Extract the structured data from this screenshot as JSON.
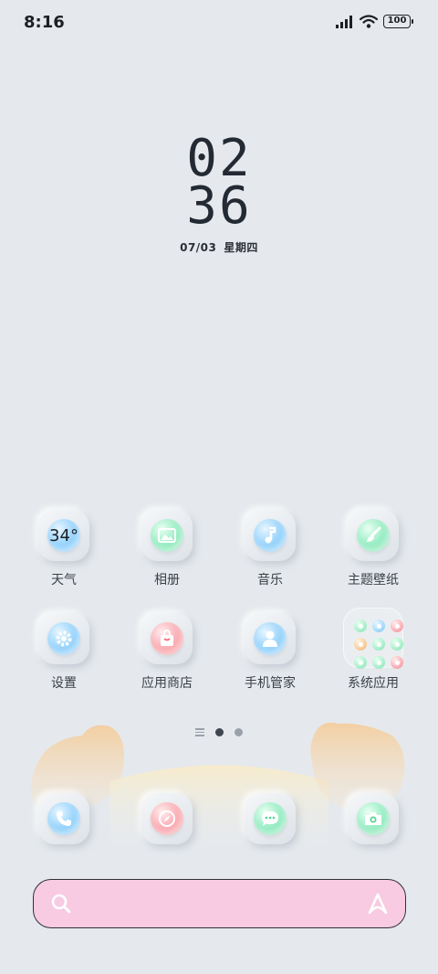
{
  "status_bar": {
    "time": "8:16",
    "battery": "100",
    "icons": [
      "signal-icon",
      "wifi-icon",
      "battery-icon"
    ]
  },
  "clock": {
    "hours": "02",
    "minutes": "36",
    "date": "07/03",
    "weekday": "星期四"
  },
  "apps": [
    {
      "label": "天气",
      "icon": "weather-icon",
      "value": "34°",
      "color": "blue"
    },
    {
      "label": "相册",
      "icon": "gallery-icon",
      "color": "green"
    },
    {
      "label": "音乐",
      "icon": "music-icon",
      "color": "blue"
    },
    {
      "label": "主题壁纸",
      "icon": "theme-brush-icon",
      "color": "green"
    },
    {
      "label": "设置",
      "icon": "settings-gear-icon",
      "color": "blue"
    },
    {
      "label": "应用商店",
      "icon": "app-store-bag-icon",
      "color": "red"
    },
    {
      "label": "手机管家",
      "icon": "phone-manager-icon",
      "color": "blue"
    },
    {
      "label": "系统应用",
      "icon": "folder-icon",
      "color": "folder"
    }
  ],
  "page_indicator": {
    "pages": 2,
    "current": 1
  },
  "dock": [
    {
      "icon": "phone-icon",
      "color": "blue"
    },
    {
      "icon": "browser-compass-icon",
      "color": "red"
    },
    {
      "icon": "messages-icon",
      "color": "green"
    },
    {
      "icon": "camera-icon",
      "color": "green"
    }
  ],
  "search_bar": {
    "icons": [
      "search-icon",
      "assistant-a-icon"
    ]
  },
  "colors": {
    "background": "#e5e9ed",
    "search_bar": "#f8cbe2",
    "accent_blue": "#8fd0fb",
    "accent_green": "#90ebbf",
    "accent_red": "#f9a6ad"
  }
}
